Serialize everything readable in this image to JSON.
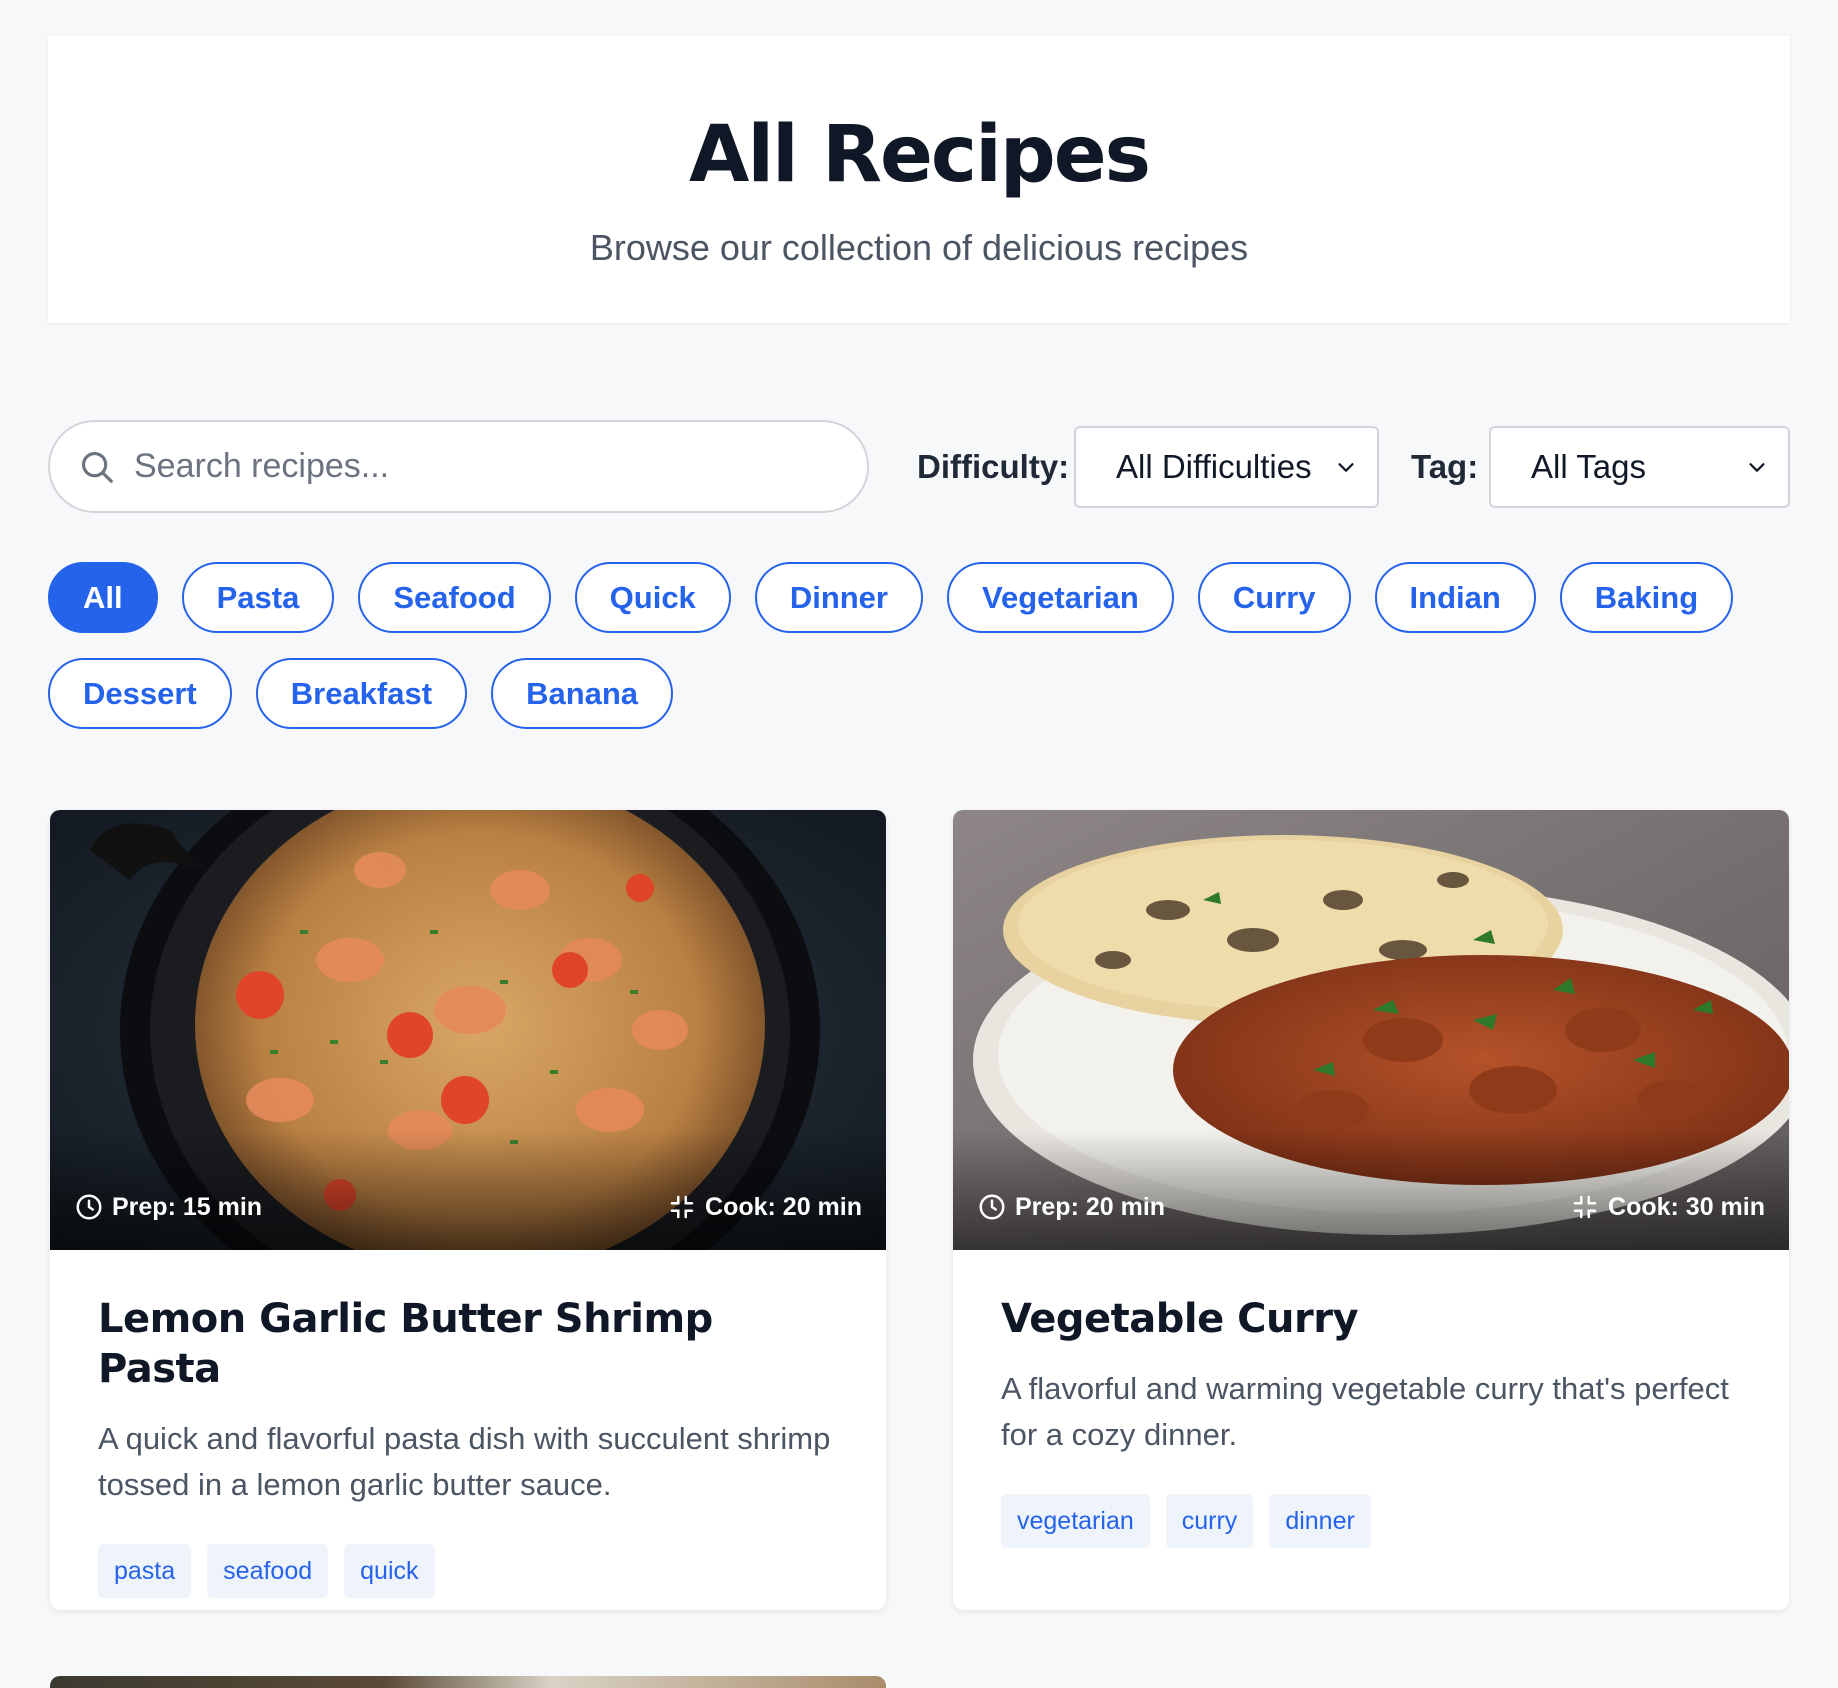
{
  "header": {
    "title": "All Recipes",
    "subtitle": "Browse our collection of delicious recipes"
  },
  "search": {
    "placeholder": "Search recipes...",
    "value": ""
  },
  "filters": {
    "difficulty_label": "Difficulty:",
    "difficulty_value": "All Difficulties",
    "tag_label": "Tag:",
    "tag_value": "All Tags"
  },
  "chips": [
    {
      "label": "All",
      "active": true
    },
    {
      "label": "Pasta"
    },
    {
      "label": "Seafood"
    },
    {
      "label": "Quick"
    },
    {
      "label": "Dinner"
    },
    {
      "label": "Vegetarian"
    },
    {
      "label": "Curry"
    },
    {
      "label": "Indian"
    },
    {
      "label": "Baking"
    },
    {
      "label": "Dessert"
    },
    {
      "label": "Breakfast"
    },
    {
      "label": "Banana"
    }
  ],
  "recipes": [
    {
      "title": "Lemon Garlic Butter Shrimp Pasta",
      "description": "A quick and flavorful pasta dish with succulent shrimp tossed in a lemon garlic butter sauce.",
      "prep": "Prep: 15 min",
      "cook": "Cook: 20 min",
      "tags": [
        "pasta",
        "seafood",
        "quick"
      ]
    },
    {
      "title": "Vegetable Curry",
      "description": "A flavorful and warming vegetable curry that's perfect for a cozy dinner.",
      "prep": "Prep: 20 min",
      "cook": "Cook: 30 min",
      "tags": [
        "vegetarian",
        "curry",
        "dinner"
      ]
    }
  ],
  "colors": {
    "accent": "#2563eb",
    "background": "#f7f8fa",
    "heading": "#101828"
  }
}
